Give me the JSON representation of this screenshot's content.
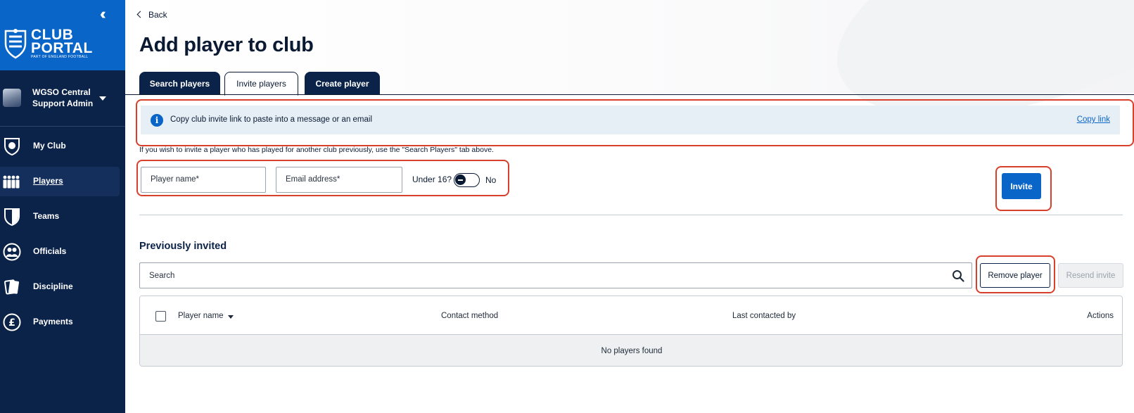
{
  "sidebar": {
    "logo_line1": "CLUB",
    "logo_line2": "PORTAL",
    "logo_tagline": "PART OF ENGLAND FOOTBALL",
    "account": {
      "line1": "WGSO Central",
      "line2": "Support Admin"
    },
    "items": [
      {
        "label": "My Club",
        "icon": "club-crest-icon"
      },
      {
        "label": "Players",
        "icon": "players-icon",
        "active": true
      },
      {
        "label": "Teams",
        "icon": "shield-icon"
      },
      {
        "label": "Officials",
        "icon": "officials-icon"
      },
      {
        "label": "Discipline",
        "icon": "cards-icon"
      },
      {
        "label": "Payments",
        "icon": "pound-icon"
      }
    ]
  },
  "header": {
    "back_label": "Back",
    "title": "Add player to club"
  },
  "tabs": [
    {
      "label": "Search players",
      "active": false
    },
    {
      "label": "Invite players",
      "active": true
    },
    {
      "label": "Create player",
      "active": false
    }
  ],
  "invite": {
    "banner_text": "Copy club invite link to paste into a message or an email",
    "copy_link_label": "Copy link",
    "hint": "If you wish to invite a player who has played for another club previously, use the \"Search Players\" tab above.",
    "player_name_placeholder": "Player name*",
    "email_placeholder": "Email address*",
    "under16_label": "Under 16?",
    "under16_value": "No",
    "invite_button": "Invite"
  },
  "previously_invited": {
    "title": "Previously invited",
    "search_placeholder": "Search",
    "remove_button": "Remove player",
    "resend_button": "Resend invite",
    "columns": [
      "Player name",
      "Contact method",
      "Last contacted by",
      "Actions"
    ],
    "empty_text": "No players found"
  },
  "colors": {
    "brand_blue": "#0a65c8",
    "navy": "#0b2249",
    "highlight_red": "#d7402b"
  }
}
